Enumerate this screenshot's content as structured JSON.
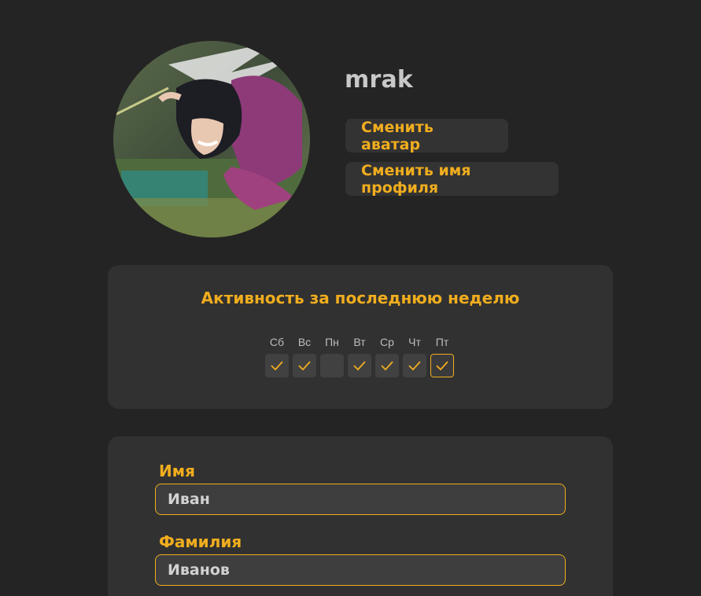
{
  "profile": {
    "username": "mrak",
    "change_avatar_label": "Сменить аватар",
    "change_name_label": "Сменить имя профиля"
  },
  "activity": {
    "title": "Активность за последнюю неделю",
    "days": [
      {
        "label": "Сб",
        "active": true,
        "today": false
      },
      {
        "label": "Вс",
        "active": true,
        "today": false
      },
      {
        "label": "Пн",
        "active": false,
        "today": false
      },
      {
        "label": "Вт",
        "active": true,
        "today": false
      },
      {
        "label": "Ср",
        "active": true,
        "today": false
      },
      {
        "label": "Чт",
        "active": true,
        "today": false
      },
      {
        "label": "Пт",
        "active": true,
        "today": true
      }
    ]
  },
  "form": {
    "first_name_label": "Имя",
    "first_name_value": "Иван",
    "last_name_label": "Фамилия",
    "last_name_value": "Иванов"
  },
  "colors": {
    "background": "#242424",
    "card": "#313131",
    "accent": "#f0ad1e",
    "text": "#c8c8c8"
  }
}
